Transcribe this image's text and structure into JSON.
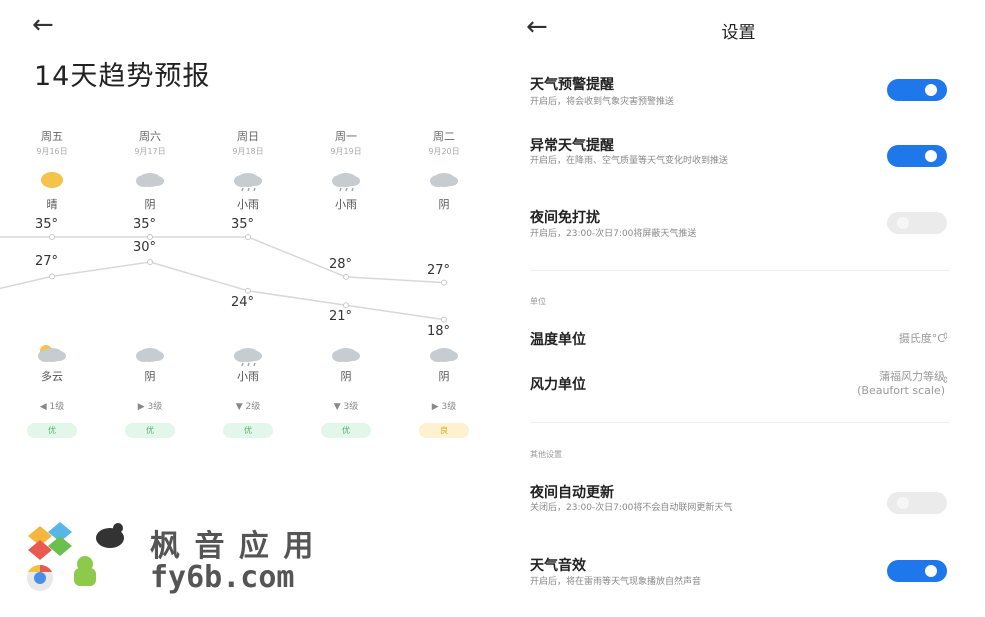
{
  "left": {
    "back_icon": "←",
    "title": "14天趋势预报",
    "days": [
      {
        "name": "周五",
        "date": "9月16日",
        "day_weather": "晴",
        "day_icon": "sun",
        "high": "35°",
        "low": "27°",
        "night_weather": "多云",
        "night_icon": "partly-cloudy",
        "wind_dir": "◀",
        "wind": "1级",
        "aqi": "优"
      },
      {
        "name": "周六",
        "date": "9月17日",
        "day_weather": "阴",
        "day_icon": "cloud",
        "high": "35°",
        "low": "30°",
        "night_weather": "阴",
        "night_icon": "cloud",
        "wind_dir": "▶",
        "wind": "3级",
        "aqi": "优"
      },
      {
        "name": "周日",
        "date": "9月18日",
        "day_weather": "小雨",
        "day_icon": "rain",
        "high": "35°",
        "low": "24°",
        "night_weather": "小雨",
        "night_icon": "rain",
        "wind_dir": "▼",
        "wind": "2级",
        "aqi": "优"
      },
      {
        "name": "周一",
        "date": "9月19日",
        "day_weather": "小雨",
        "day_icon": "rain",
        "high": "28°",
        "low": "21°",
        "night_weather": "阴",
        "night_icon": "cloud",
        "wind_dir": "▼",
        "wind": "3级",
        "aqi": "优"
      },
      {
        "name": "周二",
        "date": "9月20日",
        "day_weather": "阴",
        "day_icon": "cloud",
        "high": "27°",
        "low": "18°",
        "night_weather": "阴",
        "night_icon": "cloud",
        "wind_dir": "▶",
        "wind": "3级",
        "aqi": "良"
      }
    ],
    "colors": {
      "aqi_good": "#e3f6ea",
      "aqi_good_text": "#4cb36a",
      "aqi_fair": "#fdf1cf",
      "aqi_fair_text": "#d9a520",
      "line": "#d8d8d8",
      "sun": "#f5c24a",
      "cloud": "#c7ccd1"
    },
    "watermark": {
      "line1": "枫 音 应 用",
      "line2": "fy6b.com"
    }
  },
  "right": {
    "back_icon": "←",
    "title": "设置",
    "rows": [
      {
        "title": "天气预警提醒",
        "sub": "开启后，将会收到气象灾害预警推送",
        "on": true
      },
      {
        "title": "异常天气提醒",
        "sub": "开启后，在降雨、空气质量等天气变化时收到推送",
        "on": true
      },
      {
        "title": "夜间免打扰",
        "sub": "开启后，23:00-次日7:00将屏蔽天气推送",
        "on": false
      }
    ],
    "units_section": "单位",
    "temp_unit": {
      "label": "温度单位",
      "value": "摄氏度°C"
    },
    "wind_unit": {
      "label": "风力单位",
      "value_line1": "蒲福风力等级",
      "value_line2": "(Beaufort scale)"
    },
    "other_section": "其他设置",
    "rows2": [
      {
        "title": "夜间自动更新",
        "sub": "关闭后，23:00-次日7:00将不会自动联网更新天气",
        "on": false
      },
      {
        "title": "天气音效",
        "sub": "开启后，将在雷雨等天气现象播放自然声音",
        "on": true
      }
    ],
    "accent": "#1e78ec"
  }
}
